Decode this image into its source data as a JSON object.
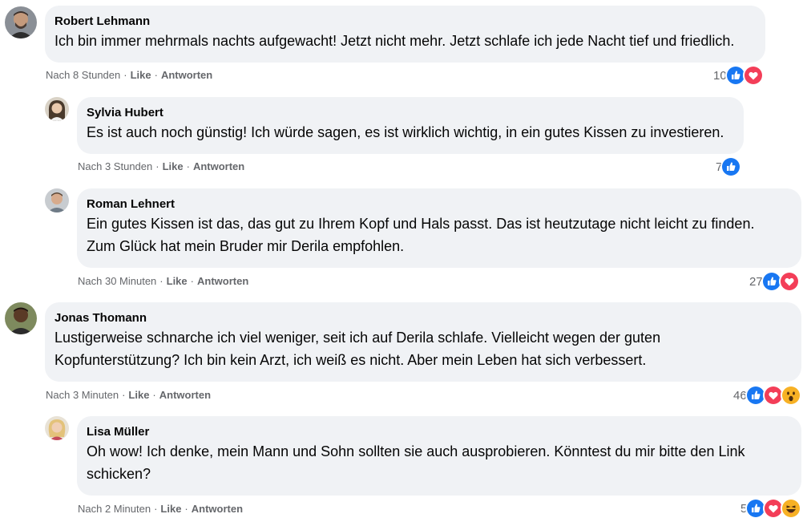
{
  "comments": [
    {
      "author": "Robert Lehmann",
      "text": "Ich bin immer mehrmals nachts aufgewacht! Jetzt nicht mehr. Jetzt schlafe ich jede Nacht tief und friedlich.",
      "time": "Nach 8 Stunden",
      "like": "Like",
      "reply": "Antworten",
      "reactions_count": "10",
      "reactions": [
        "like-icon",
        "love-icon"
      ]
    },
    {
      "author": "Sylvia Hubert",
      "text": "Es ist auch noch günstig! Ich würde sagen, es ist wirklich wichtig, in ein gutes Kissen zu investieren.",
      "time": "Nach 3 Stunden",
      "like": "Like",
      "reply": "Antworten",
      "reactions_count": "7",
      "reactions": [
        "like-icon"
      ]
    },
    {
      "author": "Roman Lehnert",
      "text_lines": [
        "Ein gutes Kissen ist das, das gut zu Ihrem Kopf und Hals passt. Das ist heutzutage nicht leicht zu finden.",
        "Zum Glück hat mein Bruder mir Derila empfohlen."
      ],
      "time": "Nach 30 Minuten",
      "like": "Like",
      "reply": "Antworten",
      "reactions_count": "27",
      "reactions": [
        "like-icon",
        "love-icon"
      ]
    },
    {
      "author": "Jonas Thomann",
      "text_lines": [
        "Lustigerweise schnarche ich viel weniger, seit ich auf Derila schlafe. Vielleicht wegen der guten",
        "Kopfunterstützung? Ich bin kein Arzt, ich weiß es nicht. Aber mein Leben hat sich verbessert."
      ],
      "time": "Nach 3 Minuten",
      "like": "Like",
      "reply": "Antworten",
      "reactions_count": "46",
      "reactions": [
        "like-icon",
        "love-icon",
        "wow-icon"
      ]
    },
    {
      "author": "Lisa Müller",
      "text_lines": [
        "Oh wow! Ich denke, mein Mann und Sohn sollten sie auch ausprobieren. Könntest du mir bitte den Link",
        "schicken?"
      ],
      "time": "Nach 2 Minuten",
      "like": "Like",
      "reply": "Antworten",
      "reactions_count": "5",
      "reactions": [
        "like-icon",
        "love-icon",
        "haha-icon"
      ]
    }
  ],
  "colors": {
    "bubble": "#f0f2f5",
    "meta": "#65676b",
    "like_blue": "#1877f2",
    "love_red": "#f33e58",
    "emoji_yellow": "#f7b125"
  }
}
